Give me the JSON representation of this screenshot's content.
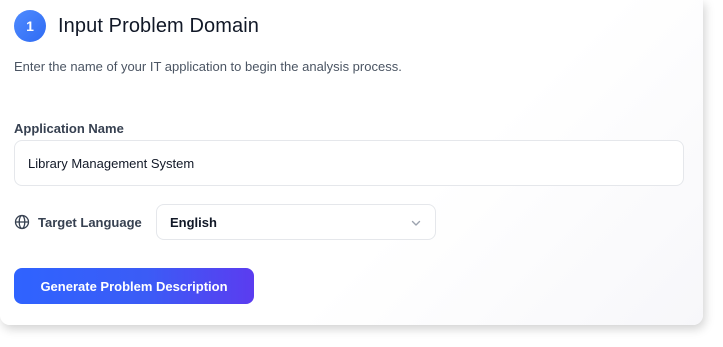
{
  "step": {
    "number": "1",
    "title": "Input Problem Domain",
    "subtitle": "Enter the name of your IT application to begin the analysis process."
  },
  "application_name": {
    "label": "Application Name",
    "value": "Library Management System"
  },
  "target_language": {
    "label": "Target Language",
    "selected": "English",
    "icon": "globe-icon"
  },
  "actions": {
    "generate_label": "Generate Problem Description"
  },
  "colors": {
    "accent": "#2f6bf3",
    "button_gradient_start": "#2f63ff",
    "button_gradient_end": "#5b3cf0"
  }
}
